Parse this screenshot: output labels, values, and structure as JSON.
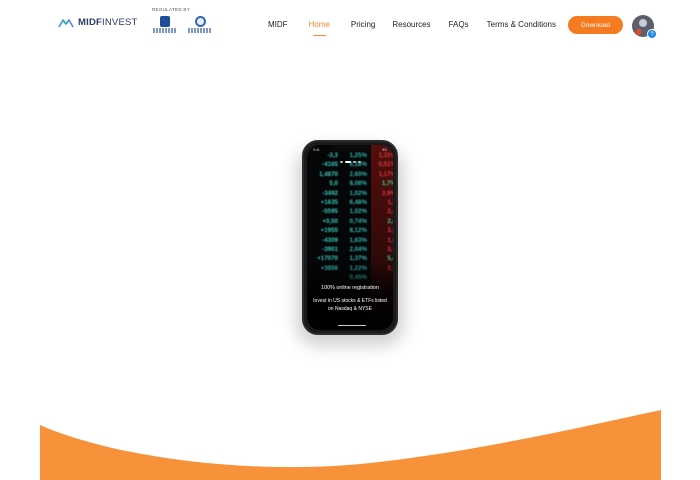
{
  "header": {
    "brand": {
      "name_bold": "MIDF",
      "name_light": "INVEST"
    },
    "regulated_label": "REGULATED BY",
    "regulators": [
      {
        "icon": "securities-commission-logo"
      },
      {
        "icon": "bank-negara-logo"
      }
    ],
    "nav_items": [
      {
        "label": "MIDF",
        "active": false
      },
      {
        "label": "Home",
        "active": true
      },
      {
        "label": "Pricing",
        "active": false
      },
      {
        "label": "Resources",
        "active": false
      },
      {
        "label": "FAQs",
        "active": false
      },
      {
        "label": "Terms & Conditions",
        "active": false
      }
    ],
    "download_label": "Download",
    "help_badge": "?"
  },
  "hero": {
    "phone": {
      "status_time": "9:41",
      "status_right": "5G",
      "tickers_left": [
        "-3,3",
        "-4165",
        "1,4870",
        "5,0",
        "-3492",
        "+1635",
        "-5595",
        "+0,50",
        "+1955",
        "-4309",
        "-3901",
        "+17070",
        "+3856"
      ],
      "tickers_mid": [
        "1,25%",
        "6,18%",
        "2,60%",
        "8,08%",
        "1,02%",
        "6,48%",
        "1,02%",
        "0,74%",
        "8,12%",
        "1,63%",
        "2,04%",
        "1,37%",
        "1,22%",
        "0,45%"
      ],
      "tickers_right": [
        "1,31%",
        "0,51%",
        "1,17%",
        "1,7%",
        "3,9%",
        "1,3",
        "2,4",
        "2,4",
        "3,3",
        "1,5",
        "3,1",
        "5,4",
        "3,3"
      ],
      "slide_title": "100% online registration",
      "slide_subtitle": "Invest in US stocks & ETFs listed on Nasdaq & NYSE"
    }
  },
  "colors": {
    "accent": "#f58a2b",
    "download_bg": "#f47b20",
    "brand_navy": "#2b3a67",
    "wave": "#f7923a"
  }
}
